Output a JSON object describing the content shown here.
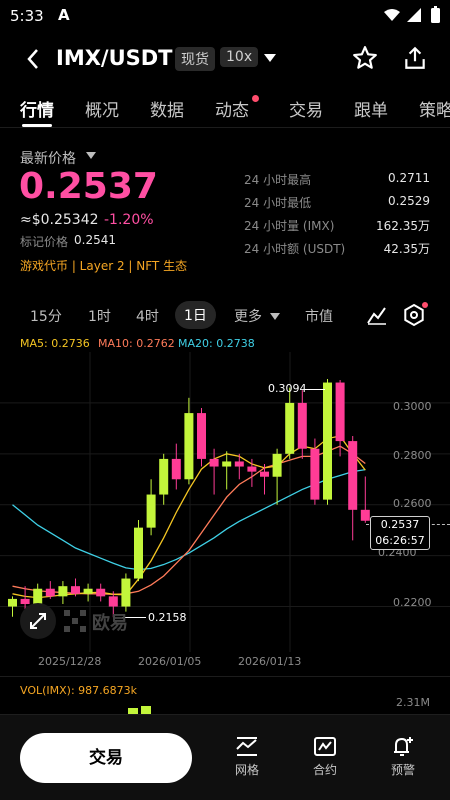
{
  "status_bar": {
    "time": "5:33"
  },
  "header": {
    "pair": "IMX/USDT",
    "market_badge": "现货",
    "leverage_badge": "10x"
  },
  "tabs": [
    "行情",
    "概况",
    "数据",
    "动态",
    "交易",
    "跟单",
    "策略"
  ],
  "price": {
    "label": "最新价格",
    "last": "0.2537",
    "usd": "≈$0.25342",
    "change": "-1.20%",
    "mark_label": "标记价格",
    "mark_value": "0.2541",
    "tags": "游戏代币 | Layer 2 | NFT 生态"
  },
  "stats": [
    {
      "label": "24 小时最高",
      "value": "0.2711"
    },
    {
      "label": "24 小时最低",
      "value": "0.2529"
    },
    {
      "label": "24 小时量 (IMX)",
      "value": "162.35万"
    },
    {
      "label": "24 小时额 (USDT)",
      "value": "42.35万"
    }
  ],
  "intervals": {
    "m15": "15分",
    "h1": "1时",
    "h4": "4时",
    "d1": "1日",
    "more": "更多",
    "mktcap": "市值"
  },
  "ma_legend": {
    "ma5": "MA5: 0.2736",
    "ma10": "MA10: 0.2762",
    "ma20": "MA20: 0.2738"
  },
  "chart_labels": {
    "high_marker": "0.3094",
    "low_marker": "0.2158",
    "current_price": "0.2537",
    "countdown": "06:26:57",
    "watermark": "欧易",
    "y_ticks": [
      "0.3000",
      "0.2800",
      "0.2600",
      "0.2400",
      "0.2200"
    ],
    "x_ticks": [
      "2025/12/28",
      "2026/01/05",
      "2026/01/13"
    ]
  },
  "volume": {
    "label": "VOL(IMX): 987.6873k",
    "max_label": "2.31M"
  },
  "bottom": {
    "trade": "交易",
    "grid": "网格",
    "contract": "合约",
    "alert": "预警"
  },
  "colors": {
    "up": "#c3f53b",
    "down": "#ff3c96",
    "ma5": "#f5c623",
    "ma10": "#ff7b5a",
    "ma20": "#3fd0e6",
    "change": "#ff4fa3"
  },
  "chart_data": {
    "type": "candlestick",
    "candles": [
      {
        "o": 0.22,
        "h": 0.224,
        "l": 0.216,
        "c": 0.223
      },
      {
        "o": 0.223,
        "h": 0.228,
        "l": 0.219,
        "c": 0.221
      },
      {
        "o": 0.221,
        "h": 0.229,
        "l": 0.22,
        "c": 0.227
      },
      {
        "o": 0.227,
        "h": 0.23,
        "l": 0.223,
        "c": 0.224
      },
      {
        "o": 0.224,
        "h": 0.23,
        "l": 0.221,
        "c": 0.228
      },
      {
        "o": 0.228,
        "h": 0.231,
        "l": 0.224,
        "c": 0.225
      },
      {
        "o": 0.225,
        "h": 0.229,
        "l": 0.222,
        "c": 0.227
      },
      {
        "o": 0.227,
        "h": 0.229,
        "l": 0.222,
        "c": 0.224
      },
      {
        "o": 0.224,
        "h": 0.226,
        "l": 0.2158,
        "c": 0.22
      },
      {
        "o": 0.22,
        "h": 0.233,
        "l": 0.218,
        "c": 0.231
      },
      {
        "o": 0.231,
        "h": 0.254,
        "l": 0.23,
        "c": 0.251
      },
      {
        "o": 0.251,
        "h": 0.27,
        "l": 0.248,
        "c": 0.264
      },
      {
        "o": 0.264,
        "h": 0.28,
        "l": 0.26,
        "c": 0.278
      },
      {
        "o": 0.278,
        "h": 0.284,
        "l": 0.266,
        "c": 0.27
      },
      {
        "o": 0.27,
        "h": 0.302,
        "l": 0.268,
        "c": 0.296
      },
      {
        "o": 0.296,
        "h": 0.298,
        "l": 0.275,
        "c": 0.278
      },
      {
        "o": 0.278,
        "h": 0.282,
        "l": 0.264,
        "c": 0.275
      },
      {
        "o": 0.275,
        "h": 0.281,
        "l": 0.266,
        "c": 0.277
      },
      {
        "o": 0.277,
        "h": 0.28,
        "l": 0.27,
        "c": 0.275
      },
      {
        "o": 0.275,
        "h": 0.278,
        "l": 0.267,
        "c": 0.273
      },
      {
        "o": 0.273,
        "h": 0.276,
        "l": 0.264,
        "c": 0.271
      },
      {
        "o": 0.271,
        "h": 0.282,
        "l": 0.26,
        "c": 0.28
      },
      {
        "o": 0.28,
        "h": 0.306,
        "l": 0.278,
        "c": 0.3
      },
      {
        "o": 0.3,
        "h": 0.305,
        "l": 0.278,
        "c": 0.282
      },
      {
        "o": 0.282,
        "h": 0.286,
        "l": 0.26,
        "c": 0.262
      },
      {
        "o": 0.262,
        "h": 0.3094,
        "l": 0.26,
        "c": 0.308
      },
      {
        "o": 0.308,
        "h": 0.309,
        "l": 0.279,
        "c": 0.285
      },
      {
        "o": 0.285,
        "h": 0.287,
        "l": 0.246,
        "c": 0.258
      },
      {
        "o": 0.258,
        "h": 0.2711,
        "l": 0.2529,
        "c": 0.2537
      }
    ],
    "ma5": [
      0.225,
      0.224,
      0.2235,
      0.224,
      0.2246,
      0.225,
      0.2254,
      0.2256,
      0.2248,
      0.2246,
      0.2308,
      0.238,
      0.247,
      0.257,
      0.266,
      0.274,
      0.278,
      0.28,
      0.279,
      0.276,
      0.2745,
      0.2752,
      0.28,
      0.283,
      0.282,
      0.286,
      0.287,
      0.28,
      0.2736
    ],
    "ma10": [
      0.228,
      0.227,
      0.2262,
      0.2258,
      0.2255,
      0.2252,
      0.225,
      0.225,
      0.2248,
      0.225,
      0.226,
      0.2285,
      0.232,
      0.237,
      0.242,
      0.249,
      0.256,
      0.263,
      0.268,
      0.271,
      0.2745,
      0.276,
      0.2775,
      0.279,
      0.279,
      0.281,
      0.283,
      0.28,
      0.2762
    ],
    "ma20": [
      0.26,
      0.256,
      0.252,
      0.249,
      0.246,
      0.243,
      0.241,
      0.239,
      0.237,
      0.2352,
      0.2345,
      0.235,
      0.2365,
      0.2385,
      0.241,
      0.244,
      0.247,
      0.2505,
      0.2535,
      0.256,
      0.2585,
      0.261,
      0.2635,
      0.266,
      0.268,
      0.27,
      0.2715,
      0.273,
      0.2738
    ],
    "ylim": [
      0.21,
      0.32
    ]
  }
}
